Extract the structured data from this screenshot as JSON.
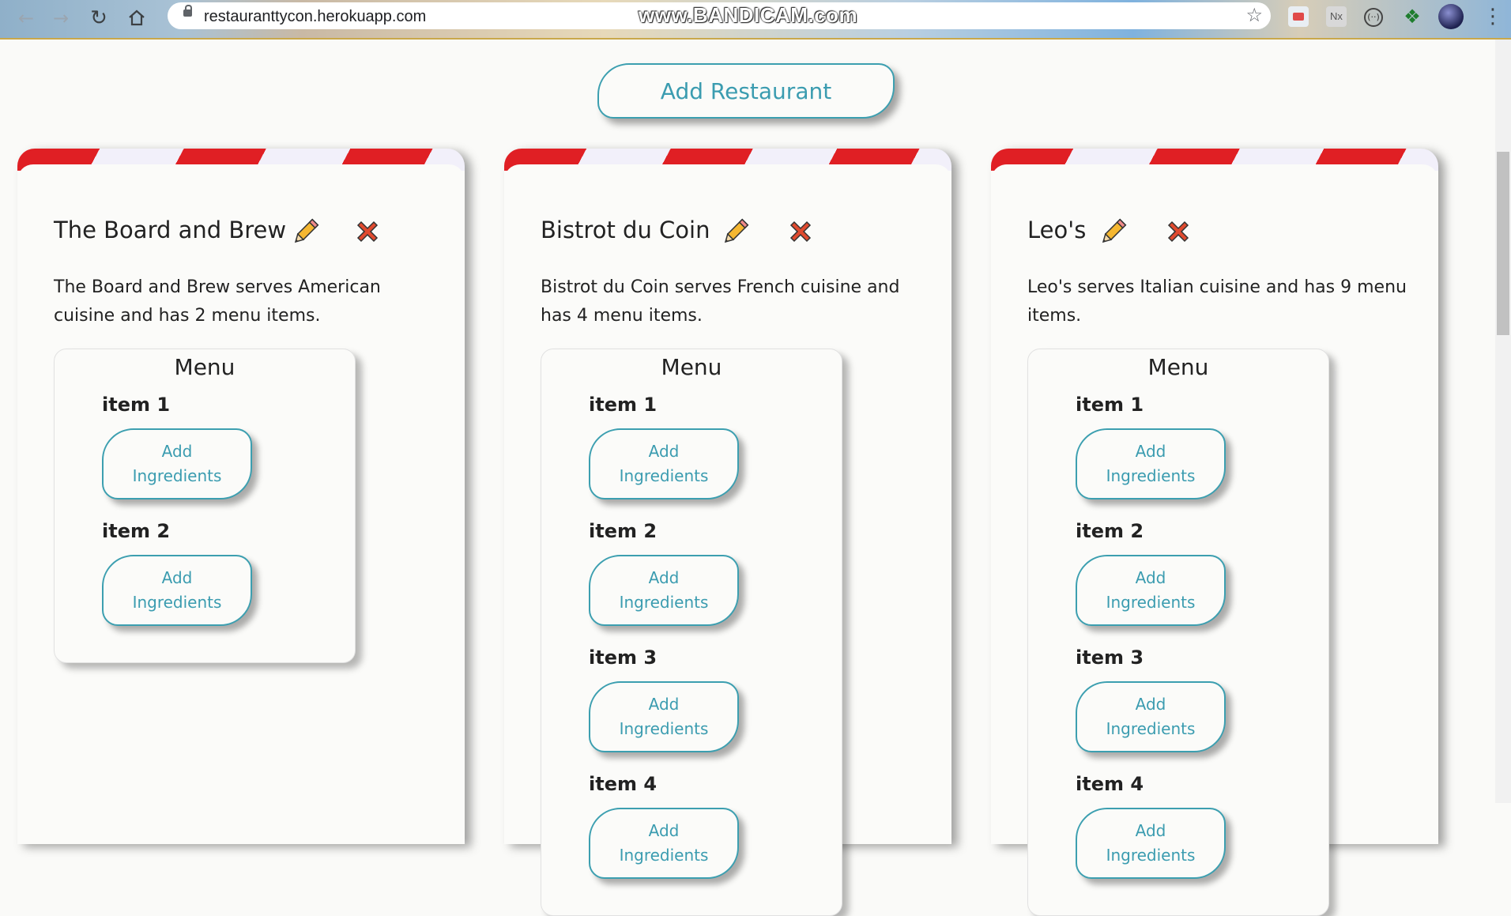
{
  "browser": {
    "url": "restauranttycon.herokuapp.com",
    "watermark": "www.BANDICAM.com",
    "ext_nx_label": "Nx",
    "ext_circle_label": "(··)"
  },
  "page": {
    "add_restaurant_label": "Add Restaurant",
    "menu_label": "Menu",
    "add_ingredients_line1": "Add",
    "add_ingredients_line2": "Ingredients"
  },
  "restaurants": [
    {
      "name": "The Board and Brew",
      "description": "The Board and Brew serves American cuisine and has 2 menu items.",
      "items": [
        "item 1",
        "item 2"
      ]
    },
    {
      "name": "Bistrot du Coin",
      "description": "Bistrot du Coin serves French cuisine and has 4 menu items.",
      "items": [
        "item 1",
        "item 2",
        "item 3",
        "item 4"
      ]
    },
    {
      "name": "Leo's",
      "description": "Leo's serves Italian cuisine and has 9 menu items.",
      "items": [
        "item 1",
        "item 2",
        "item 3",
        "item 4"
      ]
    }
  ],
  "colors": {
    "accent": "#3b9cb0",
    "stripe_red": "#e01f24",
    "delete_red": "#e04a2f",
    "pencil_yellow": "#f5b731"
  }
}
